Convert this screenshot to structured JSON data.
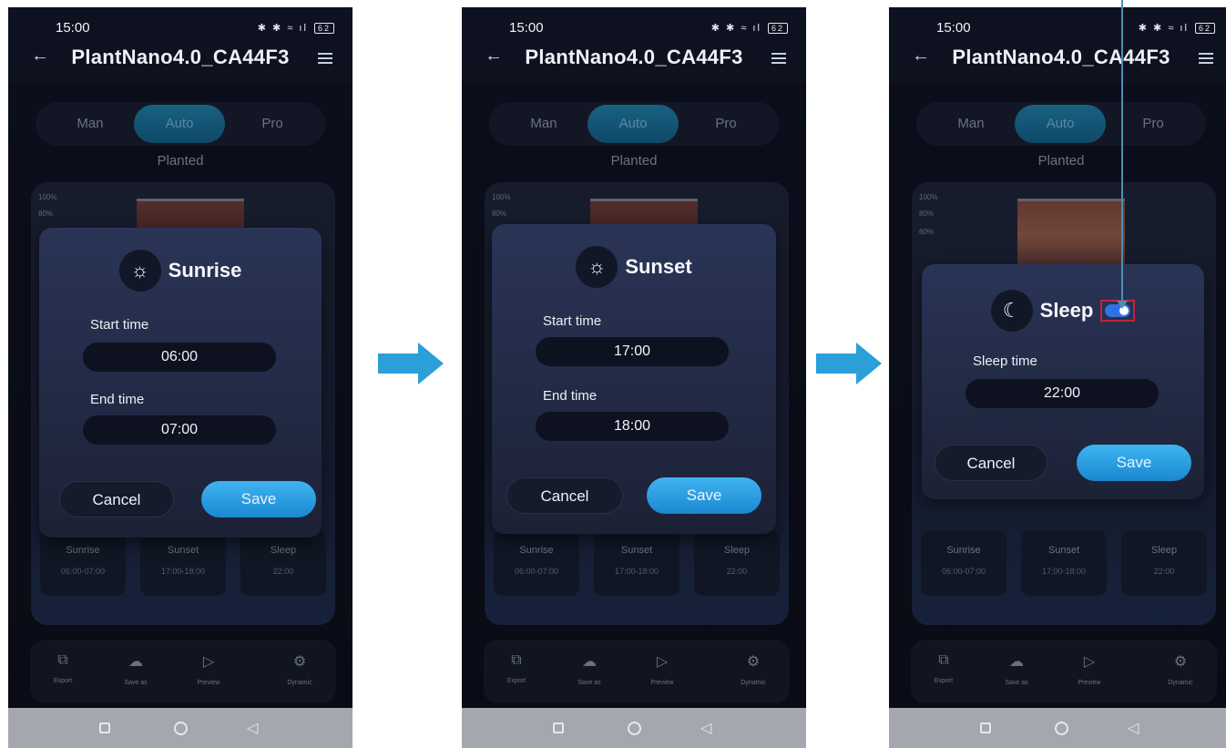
{
  "status": {
    "time": "15:00",
    "battery": "62"
  },
  "device_title": "PlantNano4.0_CA44F3",
  "modes": [
    "Man",
    "Auto",
    "Pro"
  ],
  "profile": "Planted",
  "chart_ticks": [
    "100%",
    "80%",
    "60%"
  ],
  "tiles": [
    {
      "name": "Sunrise",
      "value": "06:00-07:00"
    },
    {
      "name": "Sunset",
      "value": "17:00-18:00"
    },
    {
      "name": "Sleep",
      "value": "22:00"
    }
  ],
  "nav": [
    "Export",
    "Save as",
    "Preview",
    "Dynamic"
  ],
  "dialogs": {
    "sunrise": {
      "title": "Sunrise",
      "start_label": "Start time",
      "start": "06:00",
      "end_label": "End time",
      "end": "07:00"
    },
    "sunset": {
      "title": "Sunset",
      "start_label": "Start time",
      "start": "17:00",
      "end_label": "End time",
      "end": "18:00"
    },
    "sleep": {
      "title": "Sleep",
      "time_label": "Sleep time",
      "time": "22:00",
      "toggle_on": true
    }
  },
  "buttons": {
    "cancel": "Cancel",
    "save": "Save"
  },
  "colors": {
    "accent": "#2fa0e0",
    "arrow": "#2a9fd8",
    "highlight": "#c0263d",
    "toggle": "#2f72e6"
  }
}
